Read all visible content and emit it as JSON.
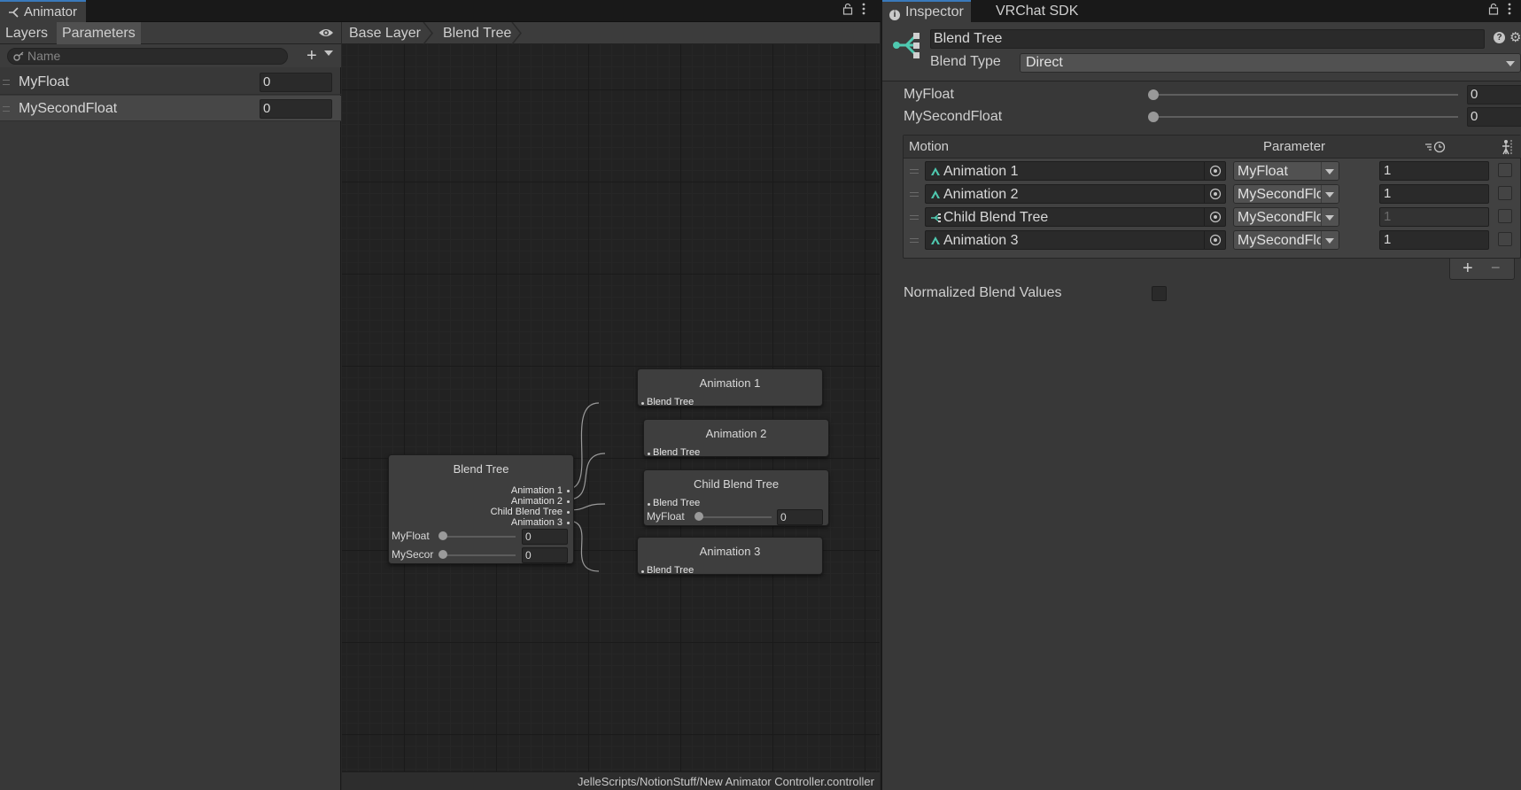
{
  "animator": {
    "window_tab": "Animator",
    "left_tabs": [
      "Layers",
      "Parameters"
    ],
    "active_left_tab": "Parameters",
    "search_placeholder": "Name",
    "parameters": [
      {
        "name": "MyFloat",
        "value": "0"
      },
      {
        "name": "MySecondFloat",
        "value": "0"
      }
    ],
    "breadcrumb": [
      "Base Layer",
      "Blend Tree"
    ],
    "status_path": "JelleScripts/NotionStuff/New Animator Controller.controller",
    "graph": {
      "root": {
        "title": "Blend Tree",
        "outputs": [
          "Animation 1",
          "Animation 2",
          "Child Blend Tree",
          "Animation 3"
        ],
        "sliders": [
          {
            "label": "MyFloat",
            "value": "0"
          },
          {
            "label": "MySecor",
            "value": "0"
          }
        ]
      },
      "children": [
        {
          "title": "Animation 1",
          "input": "Blend Tree"
        },
        {
          "title": "Animation 2",
          "input": "Blend Tree"
        },
        {
          "title": "Child Blend Tree",
          "input": "Blend Tree",
          "slider": {
            "label": "MyFloat",
            "value": "0"
          }
        },
        {
          "title": "Animation 3",
          "input": "Blend Tree"
        }
      ]
    }
  },
  "inspector": {
    "tabs": [
      "Inspector",
      "VRChat SDK"
    ],
    "name": "Blend Tree",
    "blend_type_label": "Blend Type",
    "blend_type_value": "Direct",
    "sliders": [
      {
        "label": "MyFloat",
        "value": "0"
      },
      {
        "label": "MySecondFloat",
        "value": "0"
      }
    ],
    "motion_header": {
      "motion": "Motion",
      "parameter": "Parameter"
    },
    "motions": [
      {
        "name": "Animation 1",
        "kind": "clip",
        "parameter": "MyFloat",
        "weight": "1",
        "disabled": false
      },
      {
        "name": "Animation 2",
        "kind": "clip",
        "parameter": "MySecondFloat",
        "weight": "1",
        "disabled": false
      },
      {
        "name": "Child Blend Tree",
        "kind": "tree",
        "parameter": "MySecondFloat",
        "weight": "1",
        "disabled": true
      },
      {
        "name": "Animation 3",
        "kind": "clip",
        "parameter": "MySecondFloat",
        "weight": "1",
        "disabled": false
      }
    ],
    "normalized_label": "Normalized Blend Values",
    "accent_color": "#4fc9b0"
  }
}
